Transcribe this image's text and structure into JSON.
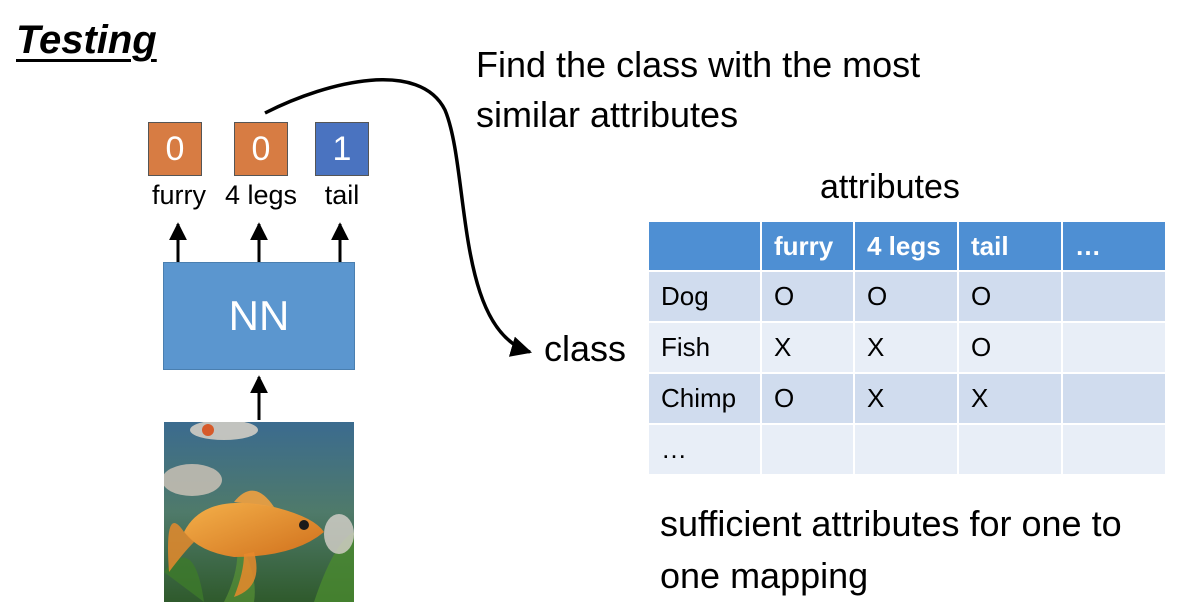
{
  "heading": "Testing",
  "instruction": "Find the class with the most similar attributes",
  "outputs": [
    {
      "value": "0",
      "label": "furry",
      "color": "#d77c43"
    },
    {
      "value": "0",
      "label": "4 legs",
      "color": "#d77c43"
    },
    {
      "value": "1",
      "label": "tail",
      "color": "#4a73c0"
    }
  ],
  "network_label": "NN",
  "class_label": "class",
  "table": {
    "title": "attributes",
    "header": [
      "",
      "furry",
      "4 legs",
      "tail",
      "…"
    ],
    "rows": [
      [
        "Dog",
        "O",
        "O",
        "O",
        ""
      ],
      [
        "Fish",
        "X",
        "X",
        "O",
        ""
      ],
      [
        "Chimp",
        "O",
        "X",
        "X",
        ""
      ],
      [
        "…",
        "",
        "",
        "",
        ""
      ]
    ]
  },
  "conclusion": "sufficient attributes for one to one mapping"
}
